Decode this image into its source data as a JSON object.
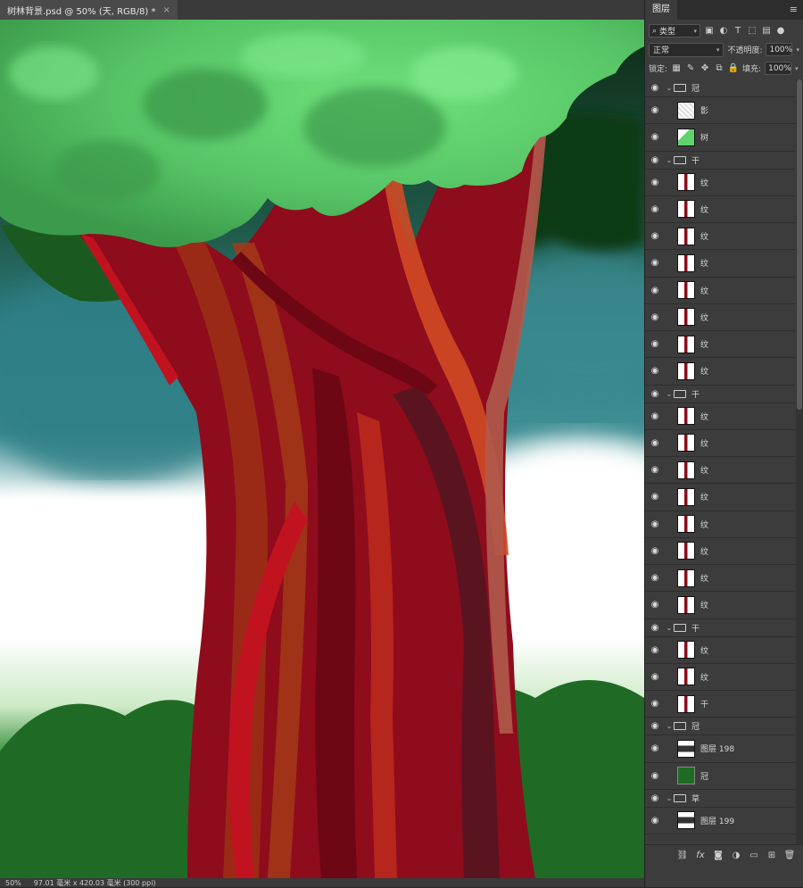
{
  "document": {
    "tab_title": "树林背景.psd @ 50% (天, RGB/8) *",
    "close_glyph": "×",
    "zoom": "50%",
    "doc_info": "97.01 毫米 x 420.03 毫米 (300 ppi)"
  },
  "panel": {
    "tab_label": "图层",
    "filter_label": "类型",
    "blend_mode": "正常",
    "opacity_label": "不透明度:",
    "opacity_value": "100%",
    "lock_label": "锁定:",
    "fill_label": "填充:",
    "fill_value": "100%"
  },
  "layers": [
    {
      "type": "group",
      "name": "冠"
    },
    {
      "type": "layer",
      "name": "影",
      "thumb": "shadow"
    },
    {
      "type": "layer",
      "name": "树",
      "thumb": "green"
    },
    {
      "type": "group",
      "name": "干"
    },
    {
      "type": "layer",
      "name": "纹",
      "thumb": "stroke"
    },
    {
      "type": "layer",
      "name": "纹",
      "thumb": "stroke"
    },
    {
      "type": "layer",
      "name": "纹",
      "thumb": "stroke"
    },
    {
      "type": "layer",
      "name": "纹",
      "thumb": "stroke"
    },
    {
      "type": "layer",
      "name": "纹",
      "thumb": "stroke"
    },
    {
      "type": "layer",
      "name": "纹",
      "thumb": "stroke"
    },
    {
      "type": "layer",
      "name": "纹",
      "thumb": "stroke"
    },
    {
      "type": "layer",
      "name": "纹",
      "thumb": "stroke"
    },
    {
      "type": "group",
      "name": "干"
    },
    {
      "type": "layer",
      "name": "纹",
      "thumb": "stroke"
    },
    {
      "type": "layer",
      "name": "纹",
      "thumb": "stroke"
    },
    {
      "type": "layer",
      "name": "纹",
      "thumb": "stroke"
    },
    {
      "type": "layer",
      "name": "纹",
      "thumb": "stroke"
    },
    {
      "type": "layer",
      "name": "纹",
      "thumb": "stroke"
    },
    {
      "type": "layer",
      "name": "纹",
      "thumb": "stroke"
    },
    {
      "type": "layer",
      "name": "纹",
      "thumb": "stroke"
    },
    {
      "type": "layer",
      "name": "纹",
      "thumb": "stroke"
    },
    {
      "type": "group",
      "name": "干"
    },
    {
      "type": "layer",
      "name": "纹",
      "thumb": "stroke"
    },
    {
      "type": "layer",
      "name": "纹",
      "thumb": "stroke"
    },
    {
      "type": "layer",
      "name": "干",
      "thumb": "stroke"
    },
    {
      "type": "group",
      "name": "冠"
    },
    {
      "type": "layer",
      "name": "图层 198",
      "thumb": "dark"
    },
    {
      "type": "layer",
      "name": "冠",
      "thumb": "darkgreen"
    },
    {
      "type": "group",
      "name": "草"
    },
    {
      "type": "layer",
      "name": "图层 199",
      "thumb": "dark"
    }
  ],
  "colors": {
    "sky_teal": "#2e7f86",
    "mist_white": "#ffffff",
    "canopy_green": "#5fd46e",
    "bush_green": "#1f6b26",
    "trunk_red": "#8e0c1c",
    "panel_bg": "#3c3c3c"
  }
}
